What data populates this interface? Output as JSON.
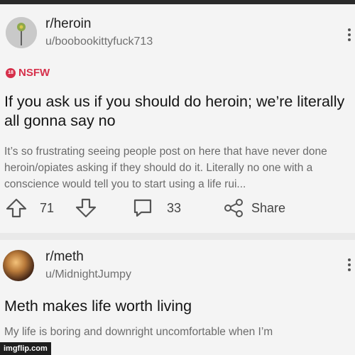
{
  "post1": {
    "community": "r/heroin",
    "username": "u/boobookittyfuck713",
    "badge": "NSFW",
    "badge_icon": "18",
    "title": "If you ask us if you should do heroin; we’re literally all gonna say no",
    "body": "It’s so frustrating seeing people post on here that have never done heroin/opiates asking if they should do it.  Literally no one with a conscience would tell you to start using a life rui...",
    "upvotes": "71",
    "comments": "33",
    "share_label": "Share"
  },
  "post2": {
    "community": "r/meth",
    "username": "u/MidnightJumpy",
    "title": "Meth makes life worth living",
    "body": "My life is boring and downright uncomfortable when I’m"
  },
  "watermark": "imgflip.com",
  "colors": {
    "nsfw": "#d6304b",
    "background": "#e9e9e9",
    "card": "#f4f4f4",
    "text": "#141414",
    "muted": "#6b6b6b"
  },
  "icons": [
    "community-avatar-icon",
    "more-options-icon",
    "nsfw-icon",
    "upvote-arrow-icon",
    "downvote-arrow-icon",
    "comment-bubble-icon",
    "share-nodes-icon"
  ]
}
